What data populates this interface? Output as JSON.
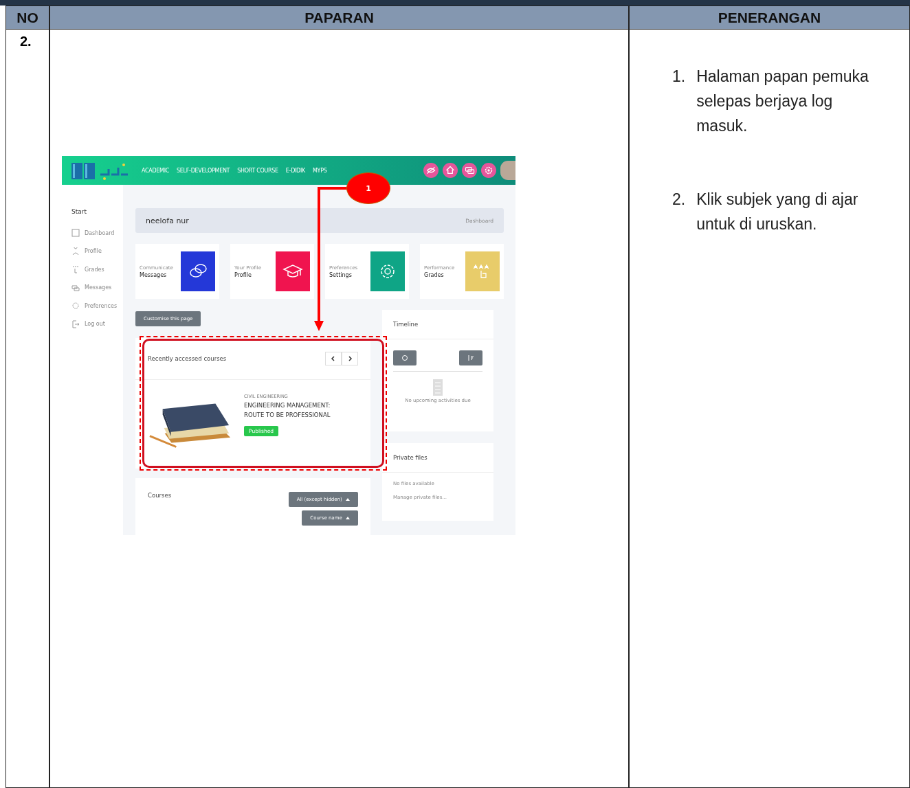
{
  "table": {
    "columns": [
      "NO",
      "PAPARAN",
      "PENERANGAN"
    ],
    "row": {
      "no": "2.",
      "explanations": [
        {
          "number": "1.",
          "text": "Halaman papan pemuka selepas berjaya log masuk."
        },
        {
          "number": "2.",
          "text": "Klik subjek yang di ajar untuk di uruskan."
        }
      ]
    }
  },
  "screenshot": {
    "nav": {
      "menu": [
        "ACADEMIC",
        "SELF-DEVELOPMENT",
        "SHORT COURSE",
        "E-DIDIK",
        "MYPS"
      ]
    },
    "sidebar": {
      "heading": "Start",
      "items": [
        {
          "kind": "dashboard",
          "label": "Dashboard"
        },
        {
          "kind": "profile",
          "label": "Profile"
        },
        {
          "kind": "grades",
          "label": "Grades"
        },
        {
          "kind": "messages",
          "label": "Messages"
        },
        {
          "kind": "preferences",
          "label": "Preferences"
        },
        {
          "kind": "logout",
          "label": "Log out"
        }
      ]
    },
    "page_header": {
      "name": "neelofa nur",
      "breadcrumb": "Dashboard"
    },
    "shortcut_cards": [
      {
        "kind": "chat",
        "caption": "Communicate",
        "label": "Messages",
        "color": "#2438d8"
      },
      {
        "kind": "cap",
        "caption": "Your Profile",
        "label": "Profile",
        "color": "#f0144f"
      },
      {
        "kind": "gear",
        "caption": "Preferences",
        "label": "Settings",
        "color": "#0fa586"
      },
      {
        "kind": "stars",
        "caption": "Performance",
        "label": "Grades",
        "color": "#e8cc6a"
      }
    ],
    "customise_button": "Customise this page",
    "recent_courses": {
      "title": "Recently accessed courses",
      "course": {
        "category": "CIVIL ENGINEERING",
        "name": "ENGINEERING MANAGEMENT: ROUTE TO BE PROFESSIONAL",
        "status": "Published"
      }
    },
    "courses": {
      "title": "Courses",
      "filter": "All (except hidden)",
      "sort": "Course name"
    },
    "timeline": {
      "title": "Timeline",
      "empty": "No upcoming activities due"
    },
    "private_files": {
      "title": "Private files",
      "empty": "No files available",
      "link": "Manage private files..."
    }
  },
  "annotation": {
    "label": "1"
  }
}
